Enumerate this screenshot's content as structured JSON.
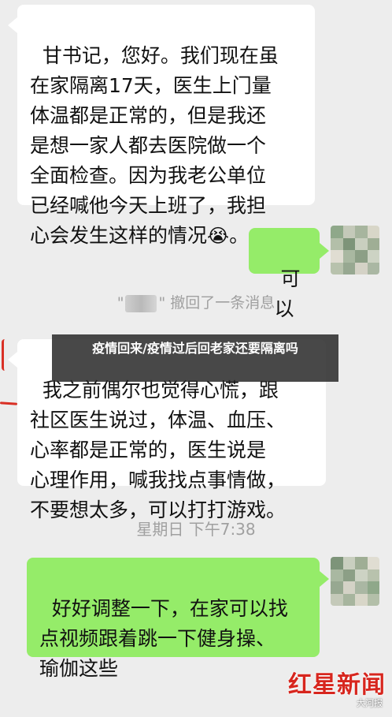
{
  "messages": [
    {
      "text": "甘书记，您好。我们现在虽\n在家隔离17天，医生上门量\n体温都是正常的，但是我还\n是想一家人都去医院做一个\n全面检查。因为我老公单位\n已经喊他今天上班了，我担\n心会发生这样的情况",
      "emoji": "😭",
      "end": "。"
    },
    {
      "text": "可以"
    },
    {
      "text": "我之前偶尔也觉得心慌，跟\n社区医生说过，体温、血压、\n心率都是正常的，医生说是\n心理作用，喊我找点事情做，\n不要想太多，可以打打游戏。"
    },
    {
      "text": "好好调整一下，在家可以找\n点视频跟着跳一下健身操、\n瑜伽这些"
    }
  ],
  "recall_notice": {
    "quote_open": "\"",
    "quote_close": "\"",
    "text": "撤回了一条消息"
  },
  "timestamp": "星期日 下午7:38",
  "banner": "疫情回来/疫情过后回老家还要隔离吗",
  "watermark": {
    "logo": "红星新闻",
    "sub": "大河报"
  },
  "colors": {
    "incoming": "#ffffff",
    "outgoing": "#95ec69",
    "background": "#ededed",
    "logo": "#d7261e"
  },
  "avatar_colors": [
    "#8fa88a",
    "#c4c9b9",
    "#a7b59e",
    "#d8d6c8",
    "#b3bfa9",
    "#7d9479",
    "#c9cfbf",
    "#9fae95",
    "#e0ddd2",
    "#a9b8a1",
    "#8c9f86",
    "#cdd3c4",
    "#b8c2ad",
    "#97a891",
    "#d4d2c6",
    "#aab7a3"
  ]
}
